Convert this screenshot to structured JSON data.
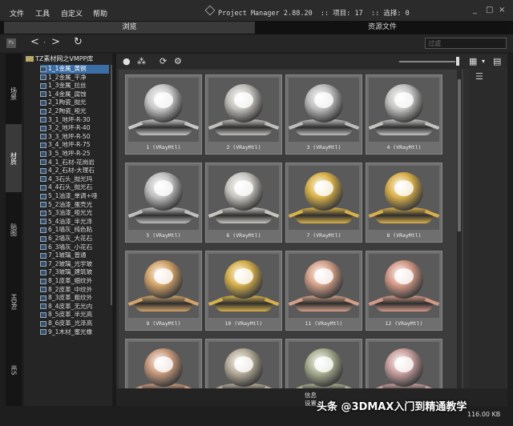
{
  "menu": [
    "文件",
    "工具",
    "自定义",
    "帮助"
  ],
  "app_title": "Project Manager 2.88.20  :: 项目: 17  :: 选择: 0",
  "window_controls": [
    "_",
    "□",
    "×"
  ],
  "tabs": {
    "browse": "浏览",
    "files": "资源文件"
  },
  "toolbar": {
    "ps_label": "Ps",
    "back": "<",
    "forward": ">",
    "dropdown": "·",
    "refresh": "↻",
    "filter_placeholder": "过滤"
  },
  "side_tabs": [
    "场景",
    "材质",
    "贴图",
    "HDRI",
    "IES"
  ],
  "tree": {
    "root": "TZ素材网之VMPP库",
    "items": [
      "1_1金属_黄铜",
      "1_2金属_干净",
      "1_3金属_拉丝",
      "1_4金属_腐蚀",
      "2_1陶瓷_抛光",
      "2_2陶瓷_哑光",
      "3_1_地坪-R-30",
      "3_2_地坪-R-40",
      "3_3_地坪-R-50",
      "3_4_地坪-R-75",
      "3_5_地坪-R-25",
      "4_1_石材-花岗岩",
      "4_2_石材-大理石",
      "4_3石头_抛光玛",
      "4_4石头_抛光石",
      "5_1油漆_单调+哑",
      "5_2油漆_蛋壳光",
      "5_3油漆_哑光光",
      "5_4油漆_半光泽",
      "6_1墙灰_纯色粘",
      "6_2墙灰_大花石",
      "6_3墙灰_小花石",
      "7_1玻璃_普通",
      "7_2玻璃_光学玻",
      "7_3玻璃_建筑玻",
      "8_1皮革_细纹外",
      "8_2皮革_中纹外",
      "8_3皮革_粗纹外",
      "8_4皮革_无光内",
      "8_5皮革_半光高",
      "8_6皮革_光泽高",
      "9_1木材_蜜光橡"
    ],
    "selected_index": 0
  },
  "materials": [
    {
      "caption": "1 (VRayMtl)",
      "color": "#c8c8c8"
    },
    {
      "caption": "2 (VRayMtl)",
      "color": "#c2c0bc"
    },
    {
      "caption": "3 (VRayMtl)",
      "color": "#bdbdbd"
    },
    {
      "caption": "4 (VRayMtl)",
      "color": "#c4c4c2"
    },
    {
      "caption": "5 (VRayMtl)",
      "color": "#c0c0c0"
    },
    {
      "caption": "6 (VRayMtl)",
      "color": "#c9c7c2"
    },
    {
      "caption": "7 (VRayMtl)",
      "color": "#d8b24a"
    },
    {
      "caption": "8 (VRayMtl)",
      "color": "#d9b04c"
    },
    {
      "caption": "9 (VRayMtl)",
      "color": "#d3a46a"
    },
    {
      "caption": "10 (VRayMtl)",
      "color": "#d6b04c"
    },
    {
      "caption": "11 (VRayMtl)",
      "color": "#d3a088"
    },
    {
      "caption": "12 (VRayMtl)",
      "color": "#d49a88"
    },
    {
      "caption": "",
      "color": "#c99b7e"
    },
    {
      "caption": "",
      "color": "#b7ae9a"
    },
    {
      "caption": "",
      "color": "#a9b091"
    },
    {
      "caption": "",
      "color": "#c9a0a0"
    }
  ],
  "info": {
    "info_label": "信息",
    "settings_label": "设置"
  },
  "status": {
    "disk_free": "116.00 KB"
  },
  "watermark": "头条 @3DMAX入门到精通教学",
  "icons": {
    "grid_tools": [
      "material-sphere-icon",
      "material-group-icon",
      "update-icon",
      "render-icon"
    ],
    "view": [
      "grid-view-icon",
      "list-menu-icon"
    ]
  }
}
